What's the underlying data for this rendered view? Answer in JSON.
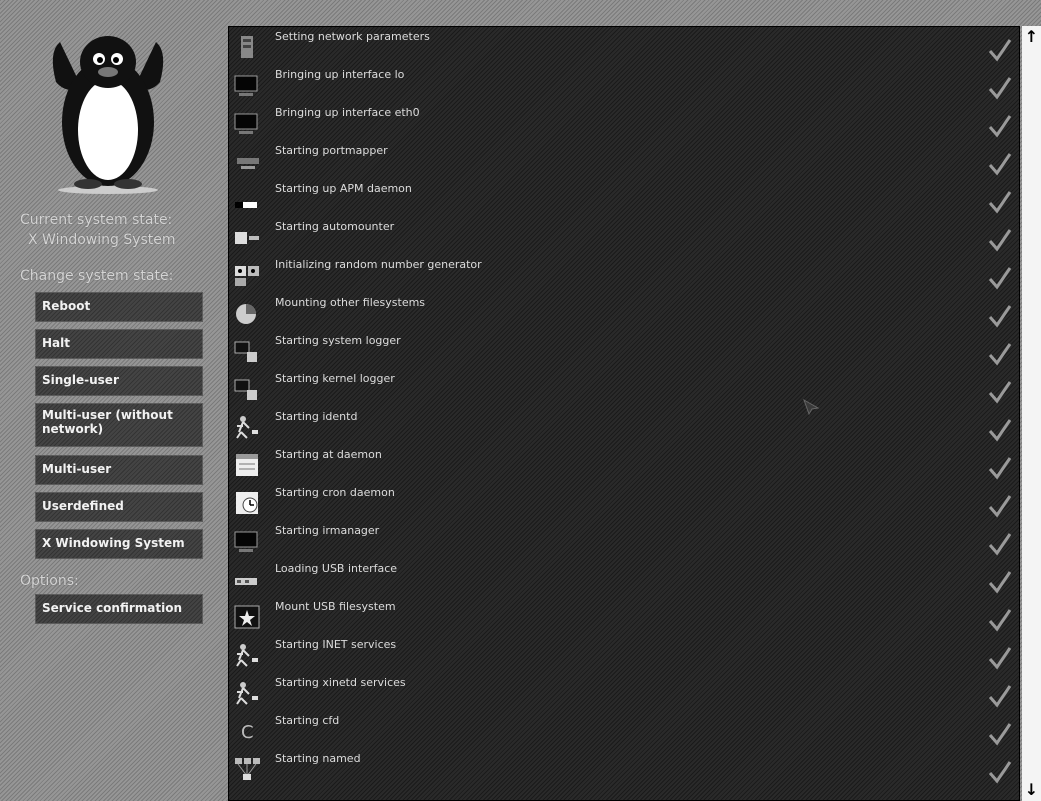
{
  "sidebar": {
    "current_state_label": "Current system state:",
    "current_state_value": "X Windowing System",
    "change_state_label": "Change system state:",
    "buttons": [
      "Reboot",
      "Halt",
      "Single-user",
      "Multi-user (without network)",
      "Multi-user",
      "Userdefined",
      "X Windowing System"
    ],
    "options_label": "Options:",
    "options_button": "Service confirmation"
  },
  "services": [
    "Setting network parameters",
    "Bringing up interface lo",
    "Bringing up interface eth0",
    "Starting portmapper",
    "Starting up APM daemon",
    "Starting automounter",
    "Initializing random number generator",
    "Mounting other filesystems",
    "Starting system logger",
    "Starting kernel logger",
    "Starting identd",
    "Starting at daemon",
    "Starting cron daemon",
    "Starting irmanager",
    "Loading USB interface",
    "Mount USB filesystem",
    "Starting INET services",
    "Starting xinetd services",
    "Starting cfd",
    "Starting named"
  ],
  "service_icons": [
    "server-icon",
    "monitor-icon",
    "monitor-icon",
    "network-icon",
    "battery-icon",
    "drive-icon",
    "dice-icon",
    "pie-icon",
    "monitor-log-icon",
    "monitor-log-icon",
    "person-icon",
    "calendar-icon",
    "clock-icon",
    "monitor-icon",
    "usb-icon",
    "star-icon",
    "person-icon",
    "person-icon",
    "c-icon",
    "network-grid-icon"
  ],
  "status_icon": "checkmark-icon",
  "scrollbar": {
    "up_glyph": "↑",
    "down_glyph": "↓"
  },
  "colors": {
    "panel": "#1e1e1e",
    "sidebar_bg": "#8a8a8a",
    "button_bg": "#3a3a3a",
    "check": "#9a9a9a"
  }
}
